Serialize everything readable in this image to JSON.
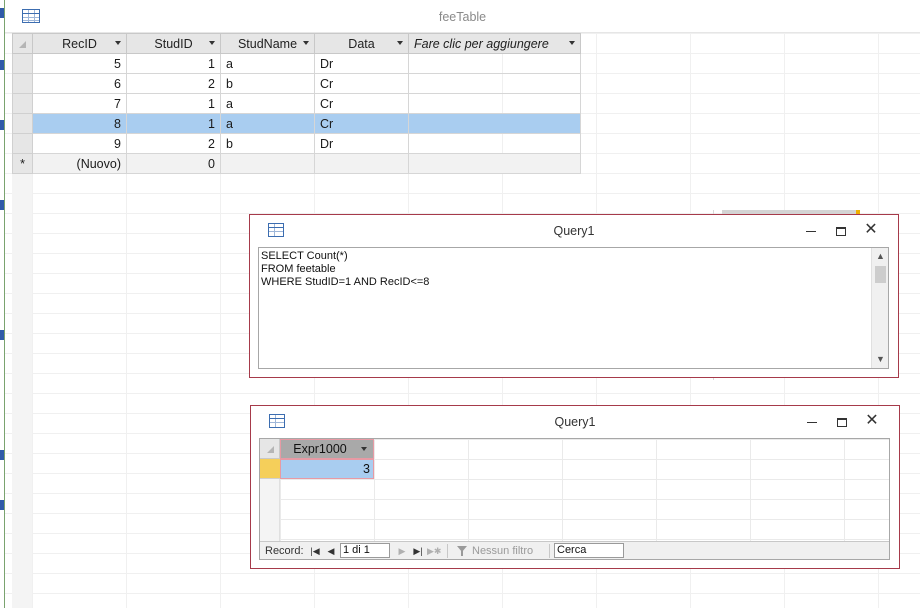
{
  "fee_table": {
    "title": "feeTable",
    "columns": [
      "RecID",
      "StudID",
      "StudName",
      "Data",
      "Fare clic per aggiungere"
    ],
    "rows": [
      {
        "recid": "5",
        "studid": "1",
        "studname": "a",
        "data": "Dr"
      },
      {
        "recid": "6",
        "studid": "2",
        "studname": "b",
        "data": "Cr"
      },
      {
        "recid": "7",
        "studid": "1",
        "studname": "a",
        "data": "Cr"
      },
      {
        "recid": "8",
        "studid": "1",
        "studname": "a",
        "data": "Cr"
      },
      {
        "recid": "9",
        "studid": "2",
        "studname": "b",
        "data": "Dr"
      }
    ],
    "selected_row_index": 3,
    "new_row": {
      "marker": "*",
      "recid": "(Nuovo)",
      "studid": "0"
    }
  },
  "query_sql": {
    "title": "Query1",
    "sql_lines": [
      "SELECT Count(*)",
      "FROM feetable",
      "WHERE StudID=1 AND RecID<=8"
    ]
  },
  "query_result": {
    "title": "Query1",
    "column": "Expr1000",
    "value": "3",
    "nav": {
      "record_label": "Record:",
      "position": "1 di 1",
      "filter_label": "Nessun filtro",
      "search_value": "Cerca"
    }
  },
  "icons": {
    "first": "first-record-icon",
    "prev": "prev-record-icon",
    "next": "next-record-icon",
    "last": "last-record-icon",
    "new": "new-record-icon"
  },
  "colors": {
    "selected_row": "#a9cdf0",
    "window_border": "#a63a4a",
    "current_record_marker": "#f5cf5a"
  }
}
